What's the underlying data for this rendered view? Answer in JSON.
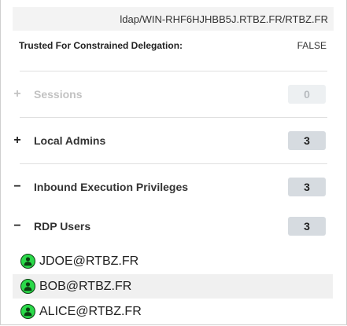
{
  "spn": "ldap/WIN-RHF6HJHBB5J.RTBZ.FR/RTBZ.FR",
  "property": {
    "label": "Trusted For Constrained Delegation:",
    "value": "FALSE"
  },
  "sections": [
    {
      "toggle": "+",
      "label": "Sessions",
      "count": "0"
    },
    {
      "toggle": "+",
      "label": "Local Admins",
      "count": "3"
    },
    {
      "toggle": "−",
      "label": "Inbound Execution Privileges",
      "count": "3"
    },
    {
      "toggle": "−",
      "label": "RDP Users",
      "count": "3"
    }
  ],
  "rdp_users": [
    {
      "name": "JDOE@RTBZ.FR",
      "icon": "user-icon"
    },
    {
      "name": "BOB@RTBZ.FR",
      "icon": "user-icon"
    },
    {
      "name": "ALICE@RTBZ.FR",
      "icon": "user-icon"
    }
  ],
  "colors": {
    "user_icon": "#2bd94a",
    "count_badge": "#d6dbe0"
  }
}
